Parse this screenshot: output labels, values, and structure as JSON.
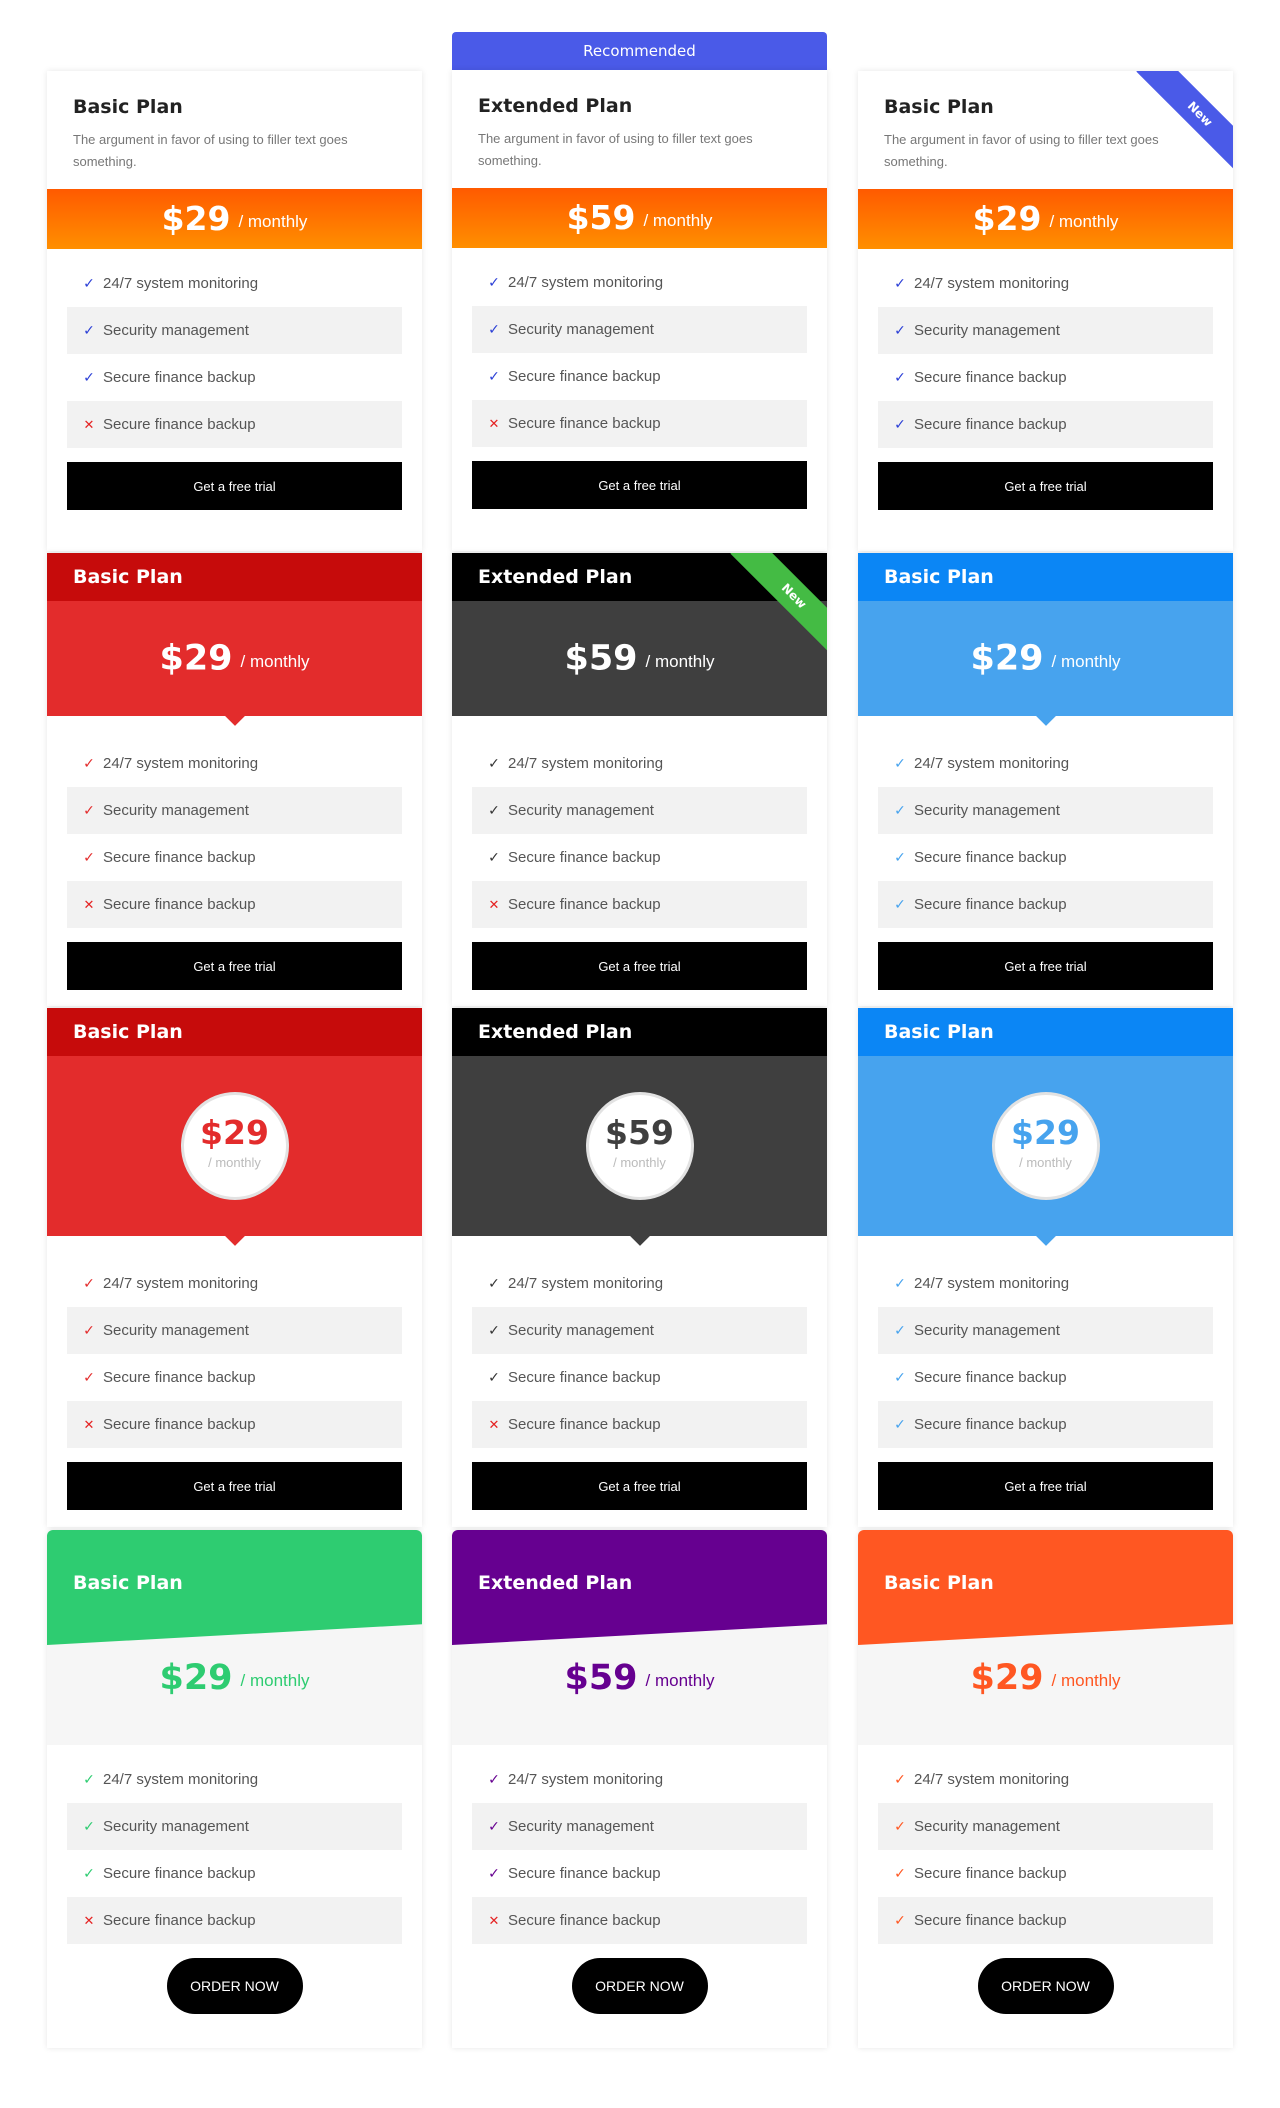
{
  "recommended_label": "Recommended",
  "ribbon_new": "New",
  "trial_label": "Get a free trial",
  "order_label": "ORDER NOW",
  "period": "/ monthly",
  "description": "The argument in favor of using to filler text goes something.",
  "plans": {
    "basic": {
      "title": "Basic Plan",
      "price": "$29"
    },
    "extended": {
      "title": "Extended Plan",
      "price": "$59"
    }
  },
  "features": [
    "24/7 system monitoring",
    "Security management",
    "Secure finance backup",
    "Secure finance backup"
  ],
  "colors": {
    "orange_gradient": [
      "#ff5a00",
      "#ff8f00"
    ],
    "red": "#e32c2c",
    "red_dark": "#c60b0b",
    "dark": "#3f3f3f",
    "black": "#000000",
    "blue": "#47a3ee",
    "blue_dark": "#0b86f5",
    "green": "#2ecc71",
    "purple": "#660090",
    "orange": "#ff5722",
    "recommended": "#4a5ae8",
    "ribbon_blue": "#4a5ae8",
    "ribbon_green": "#44bb44",
    "check_blue": "#2b3fd6",
    "cross": "#e52222"
  },
  "icons": {
    "check": "check-icon",
    "cross": "cross-icon"
  }
}
